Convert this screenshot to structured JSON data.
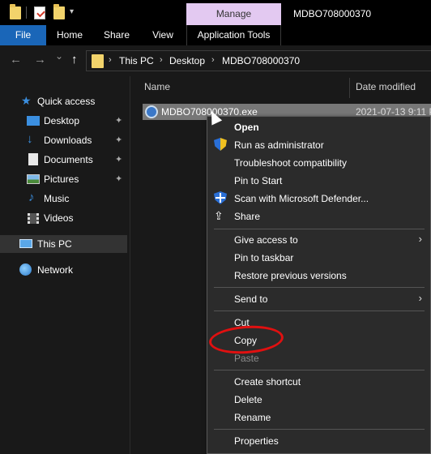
{
  "window": {
    "title": "MDBO708000370",
    "manage_tab": "Manage",
    "qat_dropdown": "▾"
  },
  "ribbon": {
    "tabs": [
      "File",
      "Home",
      "Share",
      "View",
      "Application Tools"
    ]
  },
  "address": {
    "back_glyph": "←",
    "forward_glyph": "→",
    "recent_glyph": "⌄",
    "up_glyph": "↑",
    "crumbs": [
      "This PC",
      "Desktop",
      "MDBO708000370"
    ],
    "separator": "›"
  },
  "nav": {
    "quick_access": "Quick access",
    "items": [
      {
        "label": "Desktop",
        "icon": "desktop-icon",
        "pinned": true
      },
      {
        "label": "Downloads",
        "icon": "downloads-icon",
        "pinned": true
      },
      {
        "label": "Documents",
        "icon": "documents-icon",
        "pinned": true
      },
      {
        "label": "Pictures",
        "icon": "pictures-icon",
        "pinned": true
      },
      {
        "label": "Music",
        "icon": "music-icon",
        "pinned": false
      },
      {
        "label": "Videos",
        "icon": "videos-icon",
        "pinned": false
      }
    ],
    "this_pc": "This PC",
    "network": "Network",
    "pin_glyph": "📌"
  },
  "columns": {
    "name": "Name",
    "date": "Date modified"
  },
  "file": {
    "name": "MDBO708000370.exe",
    "date": "2021-07-13 9:11 P"
  },
  "context_menu": {
    "groups": [
      [
        {
          "label": "Open",
          "bold": true
        },
        {
          "label": "Run as administrator",
          "icon": "uac-shield-icon"
        },
        {
          "label": "Troubleshoot compatibility"
        },
        {
          "label": "Pin to Start"
        },
        {
          "label": "Scan with Microsoft Defender...",
          "icon": "defender-icon"
        },
        {
          "label": "Share",
          "icon": "share-icon"
        }
      ],
      [
        {
          "label": "Give access to",
          "submenu": true
        },
        {
          "label": "Pin to taskbar"
        },
        {
          "label": "Restore previous versions"
        }
      ],
      [
        {
          "label": "Send to",
          "submenu": true
        }
      ],
      [
        {
          "label": "Cut"
        },
        {
          "label": "Copy"
        },
        {
          "label": "Paste",
          "disabled": true
        }
      ],
      [
        {
          "label": "Create shortcut"
        },
        {
          "label": "Delete"
        },
        {
          "label": "Rename"
        }
      ],
      [
        {
          "label": "Properties"
        }
      ]
    ],
    "submenu_glyph": "›",
    "share_glyph": "⇪"
  },
  "colors": {
    "accent_file_tab": "#1a66b8",
    "manage_tab": "#e3c9f1",
    "selection": "#777777",
    "annotation": "#e01010"
  }
}
